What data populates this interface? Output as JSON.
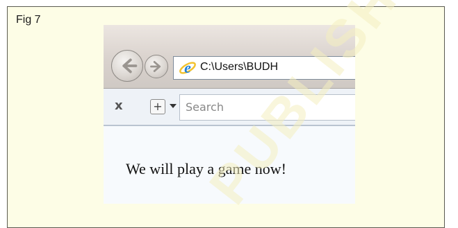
{
  "figure": {
    "label": "Fig 7"
  },
  "browser": {
    "address": "C:\\Users\\BUDH",
    "search_placeholder": "Search",
    "close_symbol": "x",
    "add_symbol": "+"
  },
  "page": {
    "text": "We will play a game now!"
  },
  "watermark": {
    "text": "PUBLISHED"
  },
  "icons": {
    "back": "back-arrow-icon",
    "forward": "forward-arrow-icon",
    "browser": "internet-explorer-icon",
    "close": "close-icon",
    "add": "plus-icon",
    "dropdown": "chevron-down-icon"
  },
  "colors": {
    "figure_background": "#fdfde6",
    "page_background": "#f7fafd",
    "ie_blue": "#1e7fd6",
    "ie_ring": "#f2c230"
  }
}
